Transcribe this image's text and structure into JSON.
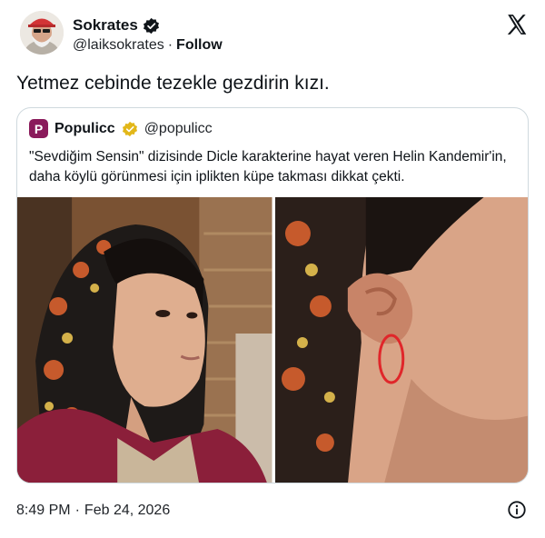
{
  "author": {
    "name": "Sokrates",
    "handle": "@laiksokrates",
    "separator": "·",
    "follow_label": "Follow"
  },
  "tweet": {
    "text": "Yetmez cebinde tezekle gezdirin kızı."
  },
  "quote": {
    "name": "Populicc",
    "handle": "@populicc",
    "logo_letter": "P",
    "text": "\"Sevdiğim Sensin\" dizisinde Dicle karakterine hayat veren Helin Kandemir'in, daha köylü görünmesi için iplikten küpe takması dikkat çekti."
  },
  "footer": {
    "time": "8:49 PM",
    "separator": "·",
    "date": "Feb 24, 2026"
  },
  "colors": {
    "verified_blue": "#1d9bf0",
    "verified_gold": "#e2b719",
    "brand_logo": "#8a1a5b"
  },
  "icons": [
    "x-logo-icon",
    "verified-badge-icon",
    "gold-verified-badge-icon",
    "info-icon"
  ]
}
